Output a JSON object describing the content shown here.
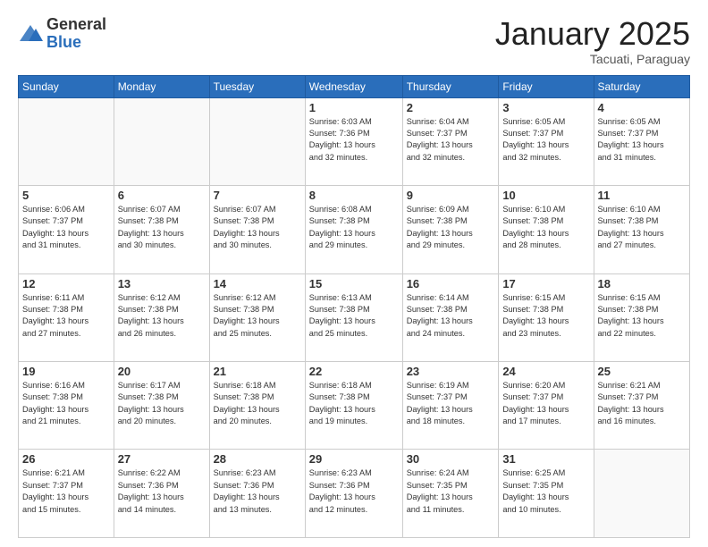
{
  "logo": {
    "general": "General",
    "blue": "Blue"
  },
  "title": "January 2025",
  "subtitle": "Tacuati, Paraguay",
  "days_of_week": [
    "Sunday",
    "Monday",
    "Tuesday",
    "Wednesday",
    "Thursday",
    "Friday",
    "Saturday"
  ],
  "weeks": [
    [
      {
        "day": "",
        "info": ""
      },
      {
        "day": "",
        "info": ""
      },
      {
        "day": "",
        "info": ""
      },
      {
        "day": "1",
        "info": "Sunrise: 6:03 AM\nSunset: 7:36 PM\nDaylight: 13 hours\nand 32 minutes."
      },
      {
        "day": "2",
        "info": "Sunrise: 6:04 AM\nSunset: 7:37 PM\nDaylight: 13 hours\nand 32 minutes."
      },
      {
        "day": "3",
        "info": "Sunrise: 6:05 AM\nSunset: 7:37 PM\nDaylight: 13 hours\nand 32 minutes."
      },
      {
        "day": "4",
        "info": "Sunrise: 6:05 AM\nSunset: 7:37 PM\nDaylight: 13 hours\nand 31 minutes."
      }
    ],
    [
      {
        "day": "5",
        "info": "Sunrise: 6:06 AM\nSunset: 7:37 PM\nDaylight: 13 hours\nand 31 minutes."
      },
      {
        "day": "6",
        "info": "Sunrise: 6:07 AM\nSunset: 7:38 PM\nDaylight: 13 hours\nand 30 minutes."
      },
      {
        "day": "7",
        "info": "Sunrise: 6:07 AM\nSunset: 7:38 PM\nDaylight: 13 hours\nand 30 minutes."
      },
      {
        "day": "8",
        "info": "Sunrise: 6:08 AM\nSunset: 7:38 PM\nDaylight: 13 hours\nand 29 minutes."
      },
      {
        "day": "9",
        "info": "Sunrise: 6:09 AM\nSunset: 7:38 PM\nDaylight: 13 hours\nand 29 minutes."
      },
      {
        "day": "10",
        "info": "Sunrise: 6:10 AM\nSunset: 7:38 PM\nDaylight: 13 hours\nand 28 minutes."
      },
      {
        "day": "11",
        "info": "Sunrise: 6:10 AM\nSunset: 7:38 PM\nDaylight: 13 hours\nand 27 minutes."
      }
    ],
    [
      {
        "day": "12",
        "info": "Sunrise: 6:11 AM\nSunset: 7:38 PM\nDaylight: 13 hours\nand 27 minutes."
      },
      {
        "day": "13",
        "info": "Sunrise: 6:12 AM\nSunset: 7:38 PM\nDaylight: 13 hours\nand 26 minutes."
      },
      {
        "day": "14",
        "info": "Sunrise: 6:12 AM\nSunset: 7:38 PM\nDaylight: 13 hours\nand 25 minutes."
      },
      {
        "day": "15",
        "info": "Sunrise: 6:13 AM\nSunset: 7:38 PM\nDaylight: 13 hours\nand 25 minutes."
      },
      {
        "day": "16",
        "info": "Sunrise: 6:14 AM\nSunset: 7:38 PM\nDaylight: 13 hours\nand 24 minutes."
      },
      {
        "day": "17",
        "info": "Sunrise: 6:15 AM\nSunset: 7:38 PM\nDaylight: 13 hours\nand 23 minutes."
      },
      {
        "day": "18",
        "info": "Sunrise: 6:15 AM\nSunset: 7:38 PM\nDaylight: 13 hours\nand 22 minutes."
      }
    ],
    [
      {
        "day": "19",
        "info": "Sunrise: 6:16 AM\nSunset: 7:38 PM\nDaylight: 13 hours\nand 21 minutes."
      },
      {
        "day": "20",
        "info": "Sunrise: 6:17 AM\nSunset: 7:38 PM\nDaylight: 13 hours\nand 20 minutes."
      },
      {
        "day": "21",
        "info": "Sunrise: 6:18 AM\nSunset: 7:38 PM\nDaylight: 13 hours\nand 20 minutes."
      },
      {
        "day": "22",
        "info": "Sunrise: 6:18 AM\nSunset: 7:38 PM\nDaylight: 13 hours\nand 19 minutes."
      },
      {
        "day": "23",
        "info": "Sunrise: 6:19 AM\nSunset: 7:37 PM\nDaylight: 13 hours\nand 18 minutes."
      },
      {
        "day": "24",
        "info": "Sunrise: 6:20 AM\nSunset: 7:37 PM\nDaylight: 13 hours\nand 17 minutes."
      },
      {
        "day": "25",
        "info": "Sunrise: 6:21 AM\nSunset: 7:37 PM\nDaylight: 13 hours\nand 16 minutes."
      }
    ],
    [
      {
        "day": "26",
        "info": "Sunrise: 6:21 AM\nSunset: 7:37 PM\nDaylight: 13 hours\nand 15 minutes."
      },
      {
        "day": "27",
        "info": "Sunrise: 6:22 AM\nSunset: 7:36 PM\nDaylight: 13 hours\nand 14 minutes."
      },
      {
        "day": "28",
        "info": "Sunrise: 6:23 AM\nSunset: 7:36 PM\nDaylight: 13 hours\nand 13 minutes."
      },
      {
        "day": "29",
        "info": "Sunrise: 6:23 AM\nSunset: 7:36 PM\nDaylight: 13 hours\nand 12 minutes."
      },
      {
        "day": "30",
        "info": "Sunrise: 6:24 AM\nSunset: 7:35 PM\nDaylight: 13 hours\nand 11 minutes."
      },
      {
        "day": "31",
        "info": "Sunrise: 6:25 AM\nSunset: 7:35 PM\nDaylight: 13 hours\nand 10 minutes."
      },
      {
        "day": "",
        "info": ""
      }
    ]
  ]
}
